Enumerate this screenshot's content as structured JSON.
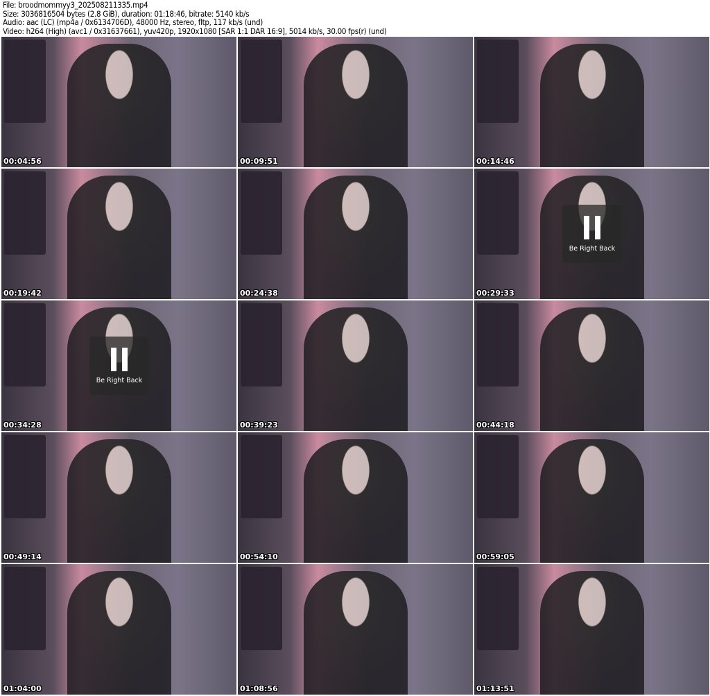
{
  "header": {
    "file": "File: broodmommyy3_202508211335.mp4",
    "size": "Size: 3036816504 bytes (2.8 GiB), duration: 01:18:46, bitrate: 5140 kb/s",
    "audio": "Audio: aac (LC) (mp4a / 0x6134706D), 48000 Hz, stereo, fltp, 117 kb/s (und)",
    "video": "Video: h264 (High) (avc1 / 0x31637661), yuv420p, 1920x1080 [SAR 1:1 DAR 16:9], 5014 kb/s, 30.00 fps(r) (und)"
  },
  "thumbnails": [
    {
      "timestamp": "00:04:56"
    },
    {
      "timestamp": "00:09:51"
    },
    {
      "timestamp": "00:14:46"
    },
    {
      "timestamp": "00:19:42"
    },
    {
      "timestamp": "00:24:38"
    },
    {
      "timestamp": "00:29:33",
      "overlay": "Be Right Back"
    },
    {
      "timestamp": "00:34:28",
      "overlay": "Be Right Back"
    },
    {
      "timestamp": "00:39:23"
    },
    {
      "timestamp": "00:44:18"
    },
    {
      "timestamp": "00:49:14"
    },
    {
      "timestamp": "00:54:10"
    },
    {
      "timestamp": "00:59:05"
    },
    {
      "timestamp": "01:04:00"
    },
    {
      "timestamp": "01:08:56"
    },
    {
      "timestamp": "01:13:51"
    }
  ]
}
